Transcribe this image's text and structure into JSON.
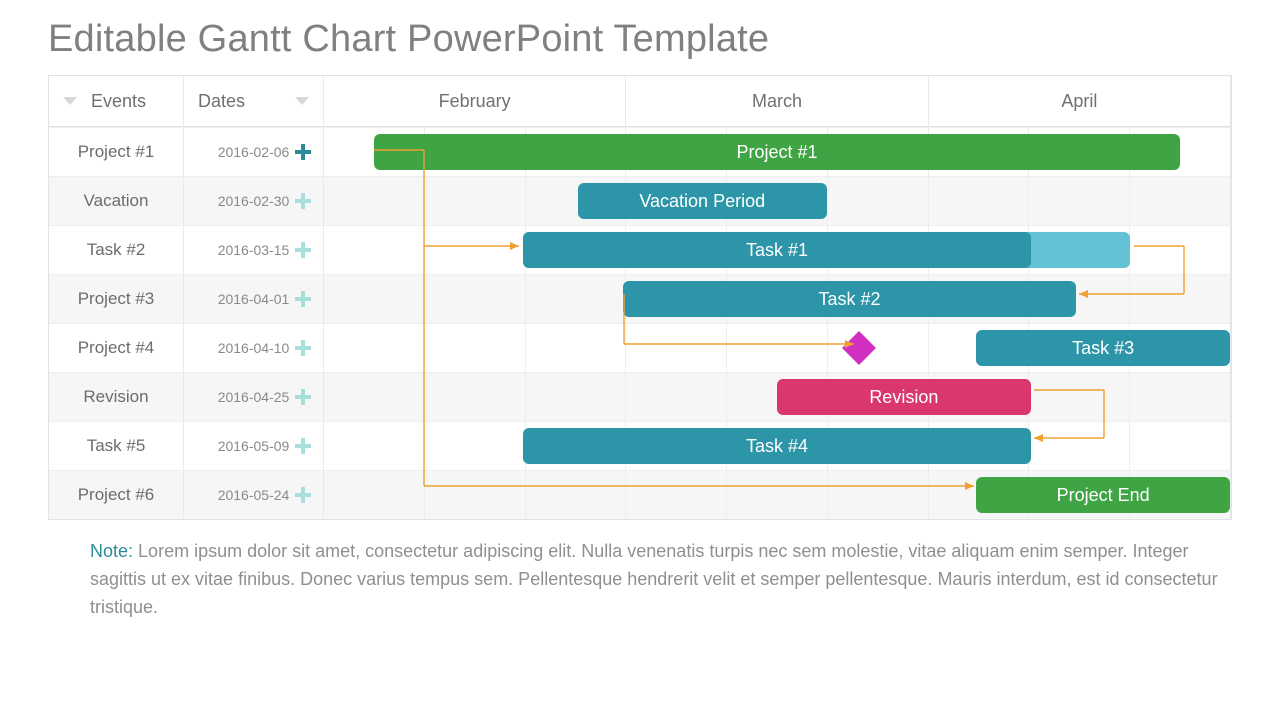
{
  "title": "Editable Gantt Chart PowerPoint Template",
  "header": {
    "events_label": "Events",
    "dates_label": "Dates",
    "months": [
      "February",
      "March",
      "April"
    ]
  },
  "rows": [
    {
      "event": "Project #1",
      "date": "2016-02-06",
      "plus_strong": true
    },
    {
      "event": "Vacation",
      "date": "2016-02-30",
      "plus_strong": false
    },
    {
      "event": "Task #2",
      "date": "2016-03-15",
      "plus_strong": false
    },
    {
      "event": "Project #3",
      "date": "2016-04-01",
      "plus_strong": false
    },
    {
      "event": "Project #4",
      "date": "2016-04-10",
      "plus_strong": false
    },
    {
      "event": "Revision",
      "date": "2016-04-25",
      "plus_strong": false
    },
    {
      "event": "Task #5",
      "date": "2016-05-09",
      "plus_strong": false
    },
    {
      "event": "Project #6",
      "date": "2016-05-24",
      "plus_strong": false
    }
  ],
  "bars": {
    "project1": "Project #1",
    "vacation": "Vacation Period",
    "task1": "Task #1",
    "task2": "Task #2",
    "task3": "Task #3",
    "revision": "Revision",
    "task4": "Task #4",
    "projectend": "Project End"
  },
  "note_label": "Note:",
  "note_text": "Lorem ipsum dolor sit amet, consectetur adipiscing elit. Nulla venenatis turpis nec sem molestie, vitae aliquam enim semper. Integer sagittis ut ex vitae finibus. Donec varius tempus sem. Pellentesque hendrerit velit et semper pellentesque. Mauris interdum, est id consectetur tristique.",
  "chart_data": {
    "type": "gantt",
    "title": "Editable Gantt Chart PowerPoint Template",
    "time_axis": {
      "unit": "month",
      "columns": [
        "February",
        "March",
        "April"
      ],
      "subticks_per_column": 3
    },
    "tasks": [
      {
        "row": 0,
        "label": "Project #1",
        "start": 0.5,
        "end": 8.5,
        "color": "#3fa544"
      },
      {
        "row": 1,
        "label": "Vacation Period",
        "start": 2.5,
        "end": 5.0,
        "color": "#2d95a8"
      },
      {
        "row": 2,
        "label": "Task #1",
        "start": 2.0,
        "end": 7.0,
        "color": "#2d95a8",
        "progress_end": 8.0,
        "progress_color": "#63c3d4"
      },
      {
        "row": 3,
        "label": "Task #2",
        "start": 3.0,
        "end": 7.5,
        "color": "#2d95a8"
      },
      {
        "row": 4,
        "label": "Task #3",
        "start": 6.5,
        "end": 9.0,
        "color": "#2d95a8"
      },
      {
        "row": 5,
        "label": "Revision",
        "start": 4.5,
        "end": 7.0,
        "color": "#d9376e"
      },
      {
        "row": 6,
        "label": "Task #4",
        "start": 2.0,
        "end": 7.0,
        "color": "#2d95a8"
      },
      {
        "row": 7,
        "label": "Project End",
        "start": 6.5,
        "end": 9.0,
        "color": "#3fa544"
      }
    ],
    "milestones": [
      {
        "row": 4,
        "at": 5.3,
        "color": "#d12fbf"
      }
    ]
  }
}
